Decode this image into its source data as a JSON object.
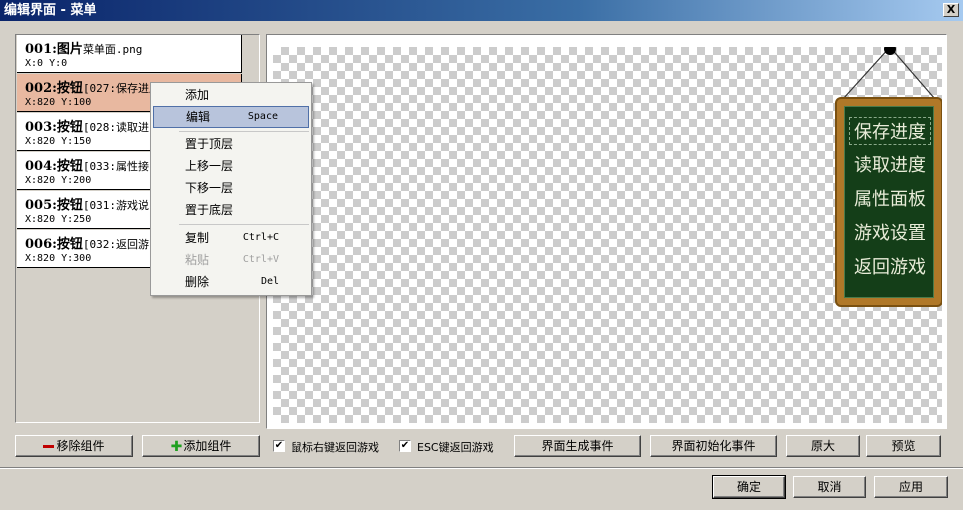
{
  "window": {
    "title": "编辑界面 - 菜单",
    "close_glyph": "X"
  },
  "component_list": [
    {
      "title": "001:图片",
      "sub": "菜单面.png",
      "coords": "X:0  Y:0",
      "selected": false
    },
    {
      "title": "002:按钮",
      "sub": "[027:保存进度]",
      "coords": "X:820  Y:100",
      "selected": true
    },
    {
      "title": "003:按钮",
      "sub": "[028:读取进",
      "coords": "X:820  Y:150",
      "selected": false
    },
    {
      "title": "004:按钮",
      "sub": "[033:属性接",
      "coords": "X:820  Y:200",
      "selected": false
    },
    {
      "title": "005:按钮",
      "sub": "[031:游戏说",
      "coords": "X:820  Y:250",
      "selected": false
    },
    {
      "title": "006:按钮",
      "sub": "[032:返回游",
      "coords": "X:820  Y:300",
      "selected": false
    }
  ],
  "context_menu": {
    "add": "添加",
    "edit": "编辑",
    "edit_shortcut": "Space",
    "to_top": "置于顶层",
    "move_up": "上移一层",
    "move_down": "下移一层",
    "to_bottom": "置于底层",
    "copy": "复制",
    "copy_shortcut": "Ctrl+C",
    "paste": "粘贴",
    "paste_shortcut": "Ctrl+V",
    "delete": "删除",
    "delete_shortcut": "Del"
  },
  "preview_menu": [
    "保存进度",
    "读取进度",
    "属性面板",
    "游戏设置",
    "返回游戏"
  ],
  "buttons": {
    "remove_component": "移除组件",
    "add_component": "添加组件",
    "right_click_return": "鼠标右键返回游戏",
    "esc_return": "ESC键返回游戏",
    "generate_event": "界面生成事件",
    "init_event": "界面初始化事件",
    "original_size": "原大",
    "preview": "预览",
    "ok": "确定",
    "cancel": "取消",
    "apply": "应用"
  },
  "checkboxes": {
    "right_click_checked": true,
    "esc_checked": true
  },
  "colors": {
    "selected_row": "#e8b8a0",
    "board_bg": "#143e18",
    "board_frame": "#b07828"
  }
}
